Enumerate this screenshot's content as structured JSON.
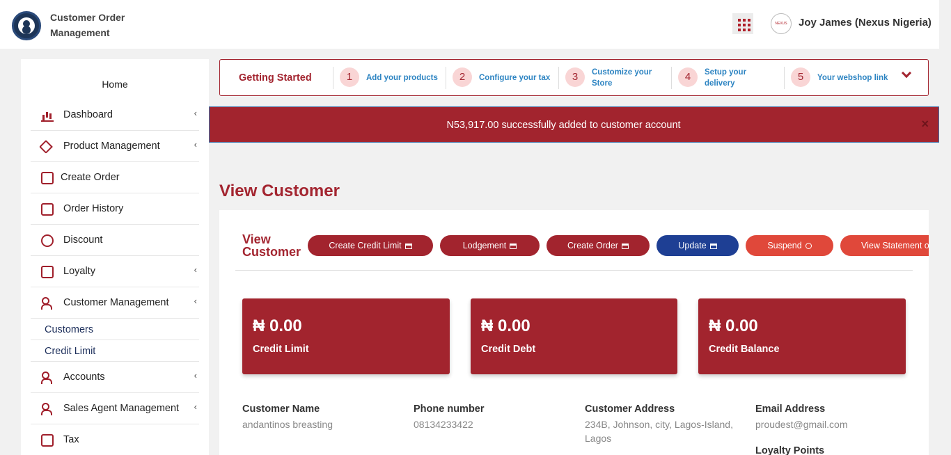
{
  "app": {
    "title": "Customer Order Management",
    "user": "Joy James (Nexus Nigeria)",
    "avatar_text": "NEXUS"
  },
  "sidebar": {
    "home": "Home",
    "items": [
      {
        "label": "Dashboard",
        "icon": "bar-chart-icon",
        "chevron": true
      },
      {
        "label": "Product Management",
        "icon": "tag-icon",
        "chevron": true
      },
      {
        "label": "Create Order",
        "icon": "shopping-bag-icon",
        "chevron": false
      },
      {
        "label": "Order History",
        "icon": "calendar-icon",
        "chevron": false
      },
      {
        "label": "Discount",
        "icon": "discount-badge-icon",
        "chevron": false
      },
      {
        "label": "Loyalty",
        "icon": "gift-icon",
        "chevron": true
      },
      {
        "label": "Customer Management",
        "icon": "users-icon",
        "chevron": true
      },
      {
        "label": "Accounts",
        "icon": "users-icon",
        "chevron": true
      },
      {
        "label": "Sales Agent Management",
        "icon": "user-check-icon",
        "chevron": true
      },
      {
        "label": "Tax",
        "icon": "percent-icon",
        "chevron": false
      }
    ],
    "sub_items": [
      "Customers",
      "Credit Limit"
    ],
    "chevron_glyph": "‹"
  },
  "getting_started": {
    "title": "Getting Started",
    "steps": [
      {
        "num": "1",
        "label": "Add your products"
      },
      {
        "num": "2",
        "label": "Configure your tax"
      },
      {
        "num": "3",
        "label": "Customize your Store"
      },
      {
        "num": "4",
        "label": "Setup your delivery"
      },
      {
        "num": "5",
        "label": "Your webshop link"
      }
    ]
  },
  "alert": {
    "message": "N53,917.00 successfully added to customer account",
    "close": "×"
  },
  "page_title": "View Customer",
  "card": {
    "title": "View Customer",
    "buttons": [
      {
        "label": "Create Credit Limit",
        "icon": "cart-icon",
        "style": "dark"
      },
      {
        "label": "Lodgement",
        "icon": "bank-icon",
        "style": "dark"
      },
      {
        "label": "Create Order",
        "icon": "cart-icon",
        "style": "dark"
      },
      {
        "label": "Update",
        "icon": "edit-icon",
        "style": "blue"
      },
      {
        "label": "Suspend",
        "icon": "ban-icon",
        "style": "orange"
      },
      {
        "label": "View Statement of Ac",
        "icon": "",
        "style": "orange"
      }
    ],
    "stats": [
      {
        "value": "₦ 0.00",
        "label": "Credit Limit"
      },
      {
        "value": "₦ 0.00",
        "label": "Credit Debt"
      },
      {
        "value": "₦ 0.00",
        "label": "Credit Balance"
      }
    ],
    "info": [
      {
        "heading": "Customer Name",
        "value": "andantinos breasting"
      },
      {
        "heading": "Phone number",
        "value": "08134233422"
      },
      {
        "heading": "Customer Address",
        "value": "234B, Johnson, city, Lagos-Island, Lagos"
      },
      {
        "heading": "Email Address",
        "value": "proudest@gmail.com"
      }
    ],
    "loyalty_heading": "Loyalty Points"
  },
  "colors": {
    "brand": "#a2242e",
    "blue": "#1e3f94",
    "orange": "#e0483a",
    "step_link": "#2d84c2"
  }
}
